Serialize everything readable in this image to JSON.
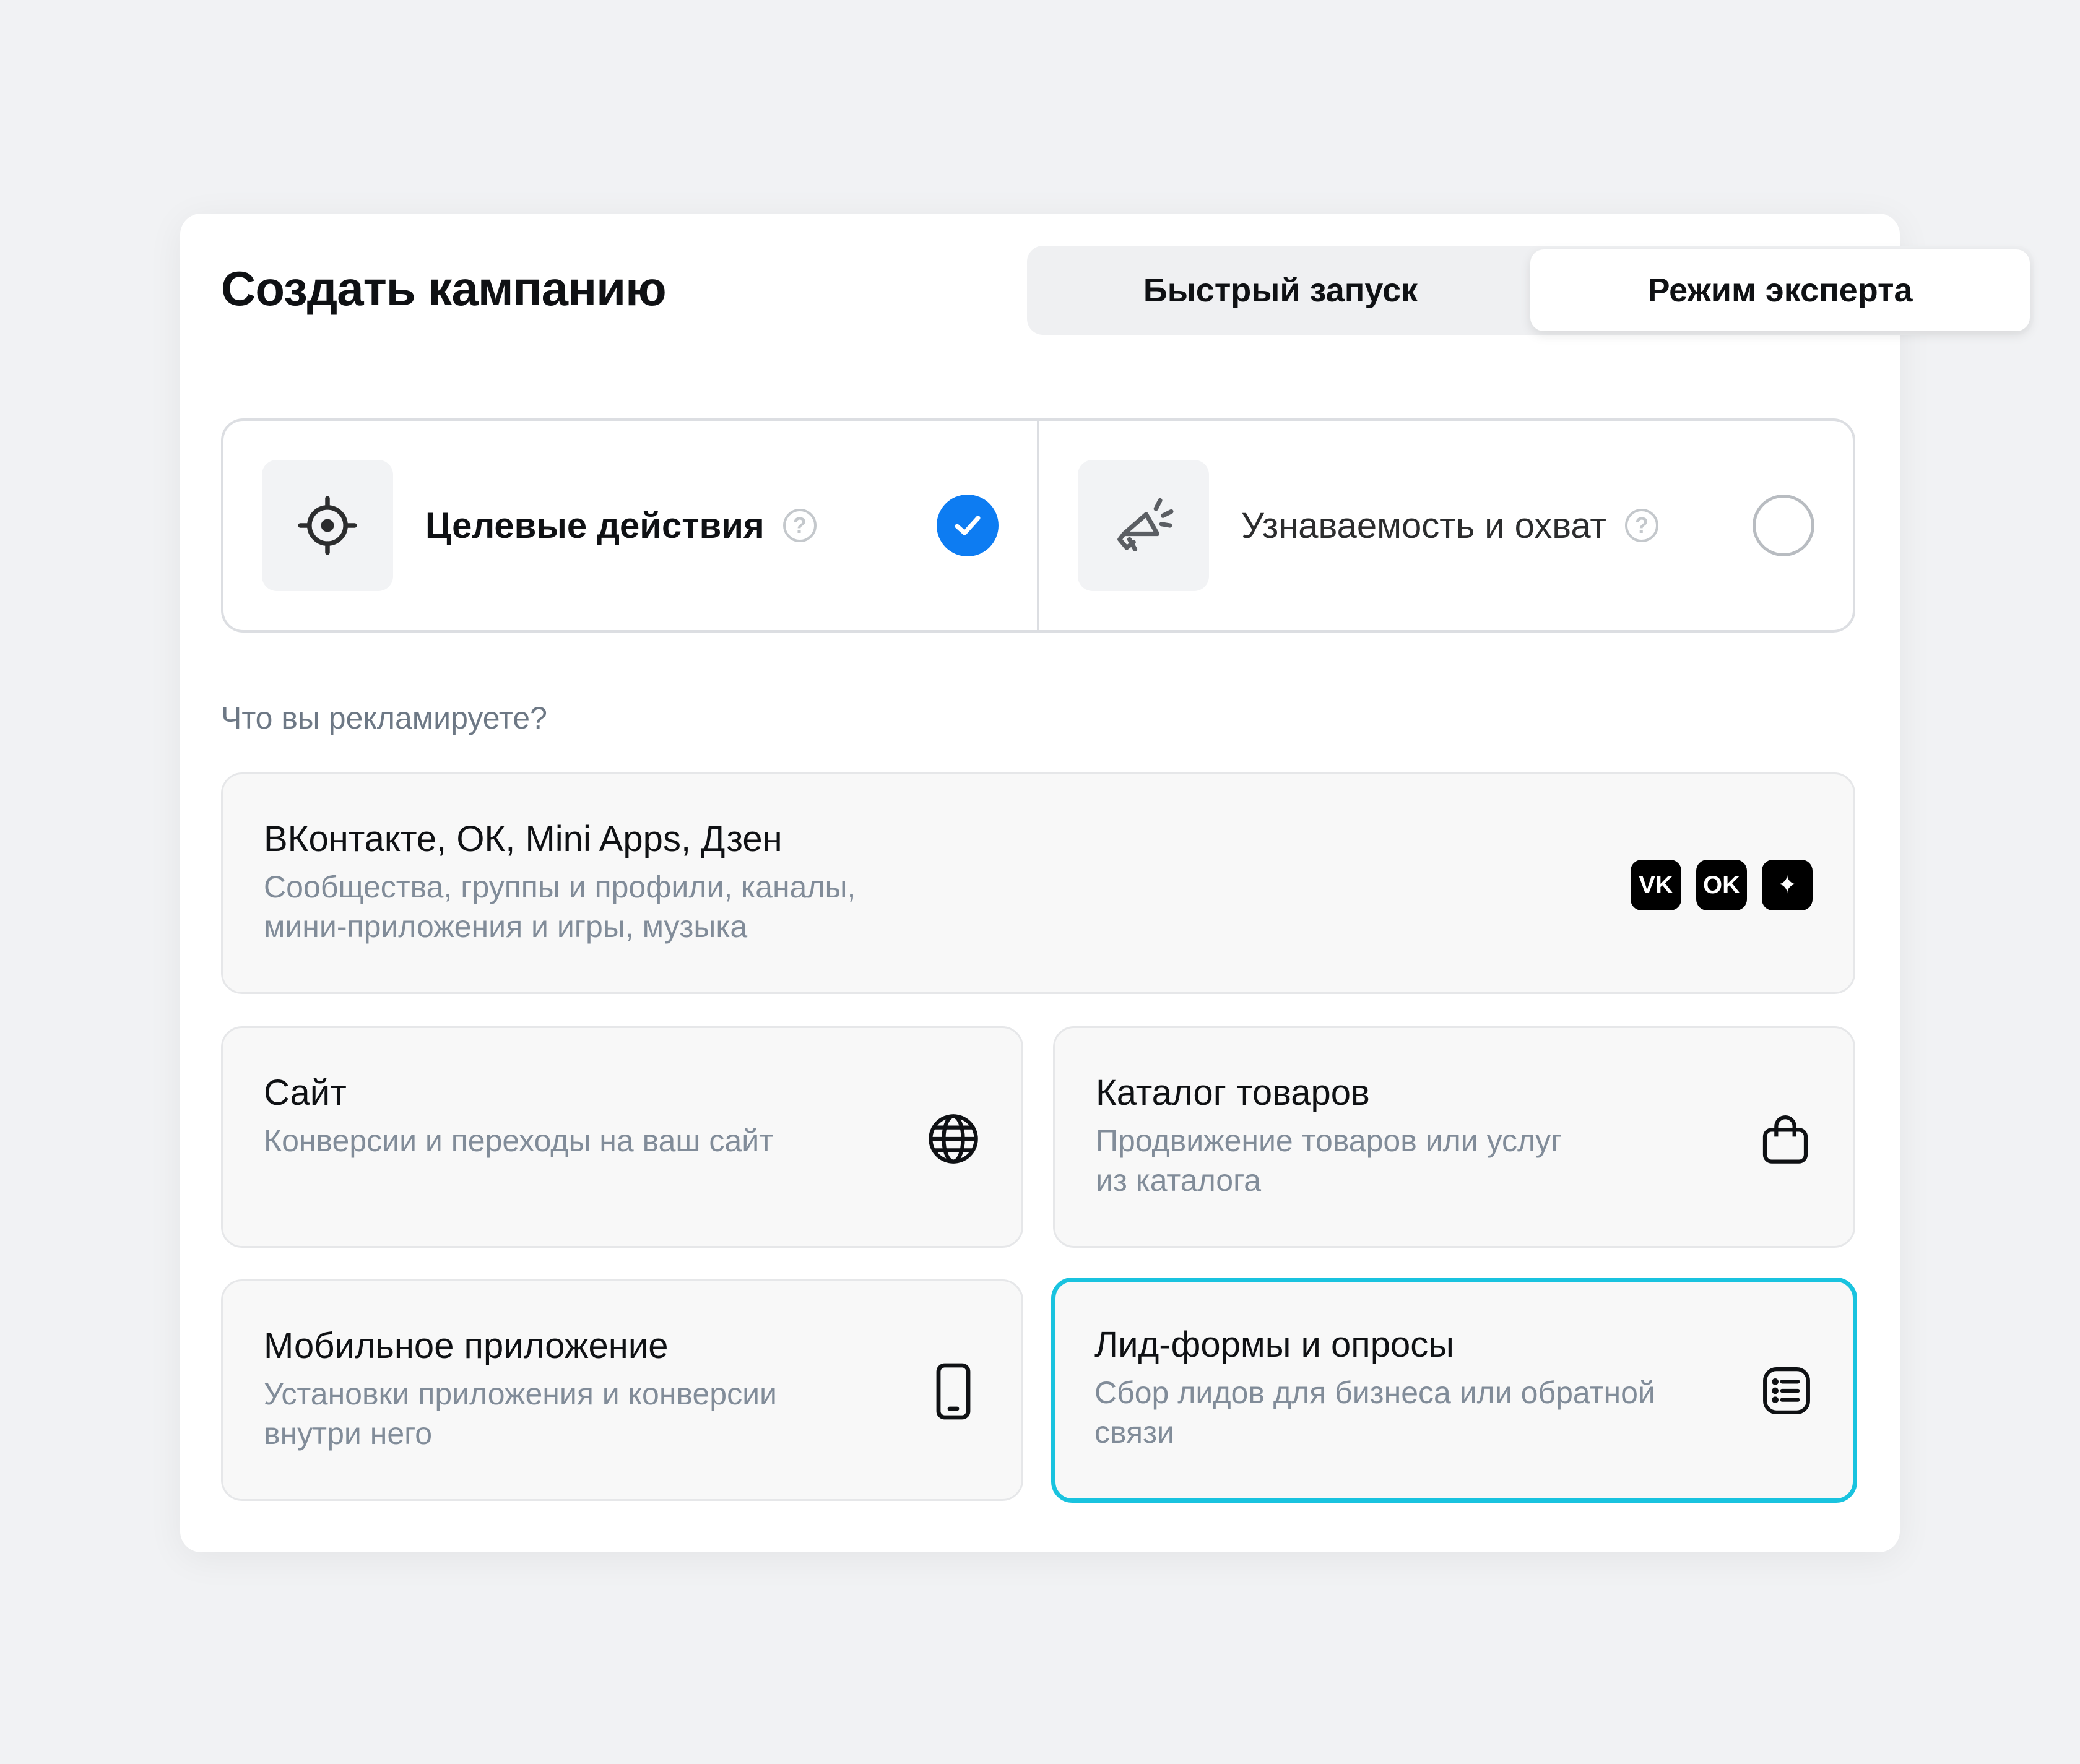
{
  "header": {
    "title": "Создать кампанию",
    "modes": [
      "Быстрый запуск",
      "Режим эксперта"
    ],
    "active_mode": "Режим эксперта"
  },
  "goals": [
    {
      "label": "Целевые действия",
      "icon": "target-icon",
      "selected": true
    },
    {
      "label": "Узнаваемость и охват",
      "icon": "megaphone-icon",
      "selected": false
    }
  ],
  "question": "Что вы рекламируете?",
  "options": [
    {
      "title": "ВКонтакте, ОК, Mini Apps, Дзен",
      "desc": "Сообщества, группы и профили, каналы,\nмини-приложения и игры, музыка",
      "icon": "vk-ok-dzen-icons",
      "social": [
        "VK",
        "OK",
        "✦"
      ]
    },
    {
      "title": "Сайт",
      "desc": "Конверсии и переходы на ваш сайт",
      "icon": "globe-icon"
    },
    {
      "title": "Каталог товаров",
      "desc": "Продвижение товаров или услуг\nиз каталога",
      "icon": "shopping-bag-icon"
    },
    {
      "title": "Мобильное приложение",
      "desc": "Установки приложения и конверсии\nвнутри него",
      "icon": "smartphone-icon"
    },
    {
      "title": "Лид-формы и опросы",
      "desc": "Сбор лидов для бизнеса или обратной\nсвязи",
      "icon": "list-form-icon",
      "highlighted": true
    }
  ],
  "colors": {
    "accent": "#0d7cf2",
    "highlight": "#19c3df"
  }
}
